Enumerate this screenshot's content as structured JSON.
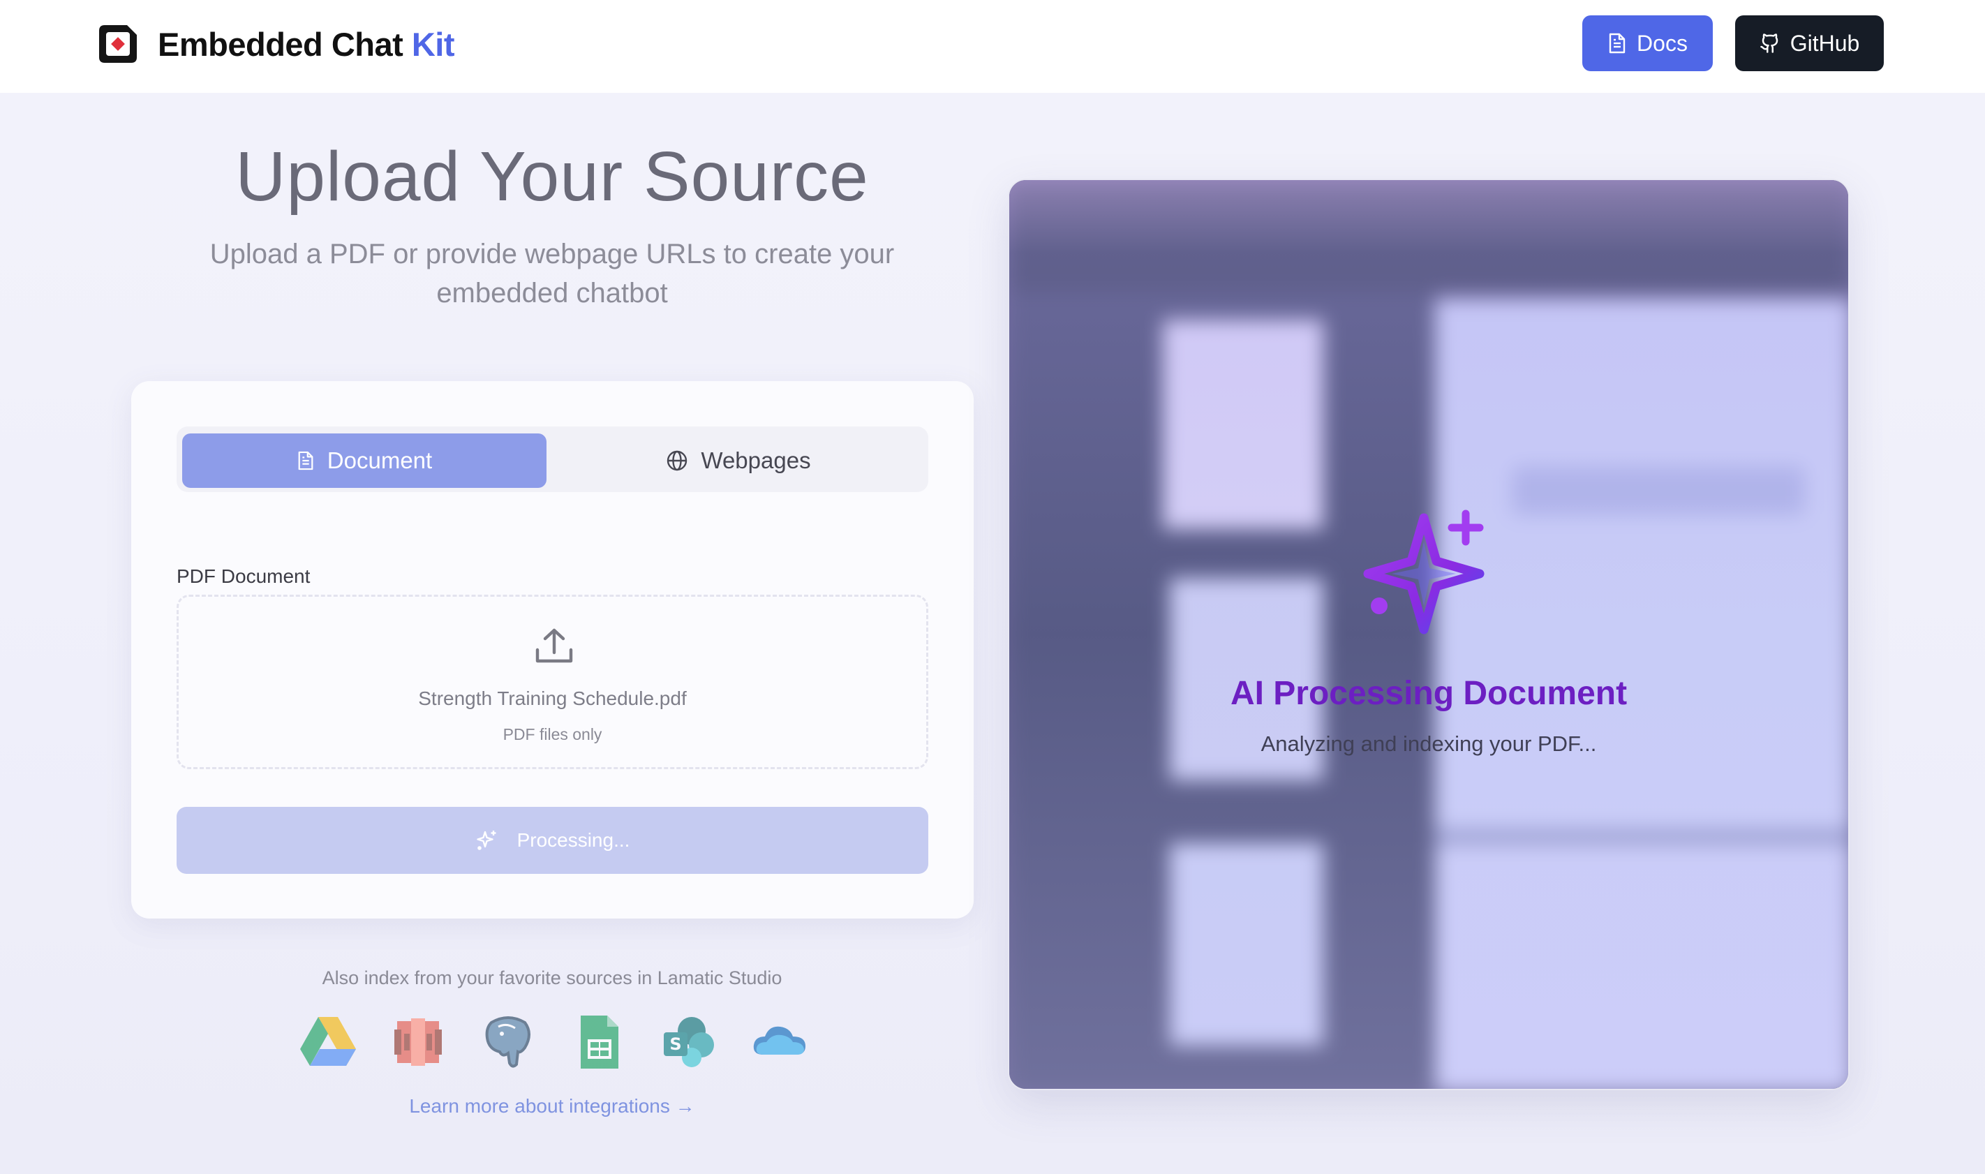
{
  "header": {
    "brand_main": "Embedded Chat ",
    "brand_accent": "Kit",
    "docs_label": "Docs",
    "github_label": "GitHub",
    "brand_color": "#4f66e6"
  },
  "hero": {
    "title": "Upload Your Source",
    "subtitle": "Upload a PDF or provide webpage URLs to create your embedded chatbot"
  },
  "form": {
    "tabs": [
      {
        "label": "Document",
        "icon": "file-text-icon",
        "active": true
      },
      {
        "label": "Webpages",
        "icon": "globe-icon",
        "active": false
      }
    ],
    "field_label": "PDF Document",
    "file_name": "Strength Training Schedule.pdf",
    "file_hint": "PDF files only",
    "submit_label": "Processing..."
  },
  "integrations": {
    "text": "Also index from your favorite sources in Lamatic Studio",
    "icons": [
      "google-drive-icon",
      "aws-s3-icon",
      "postgresql-icon",
      "google-sheets-icon",
      "sharepoint-icon",
      "onedrive-icon"
    ],
    "link": "Learn more about integrations →"
  },
  "preview": {
    "status_title": "AI Processing Document",
    "status_subtitle": "Analyzing and indexing your PDF..."
  },
  "colors": {
    "accent": "#4f67e7",
    "tab_active": "#8d9ce9",
    "processing_button": "#c5cbf1",
    "ai_purple": "#6c1fc2",
    "github_bg": "#161c26"
  }
}
